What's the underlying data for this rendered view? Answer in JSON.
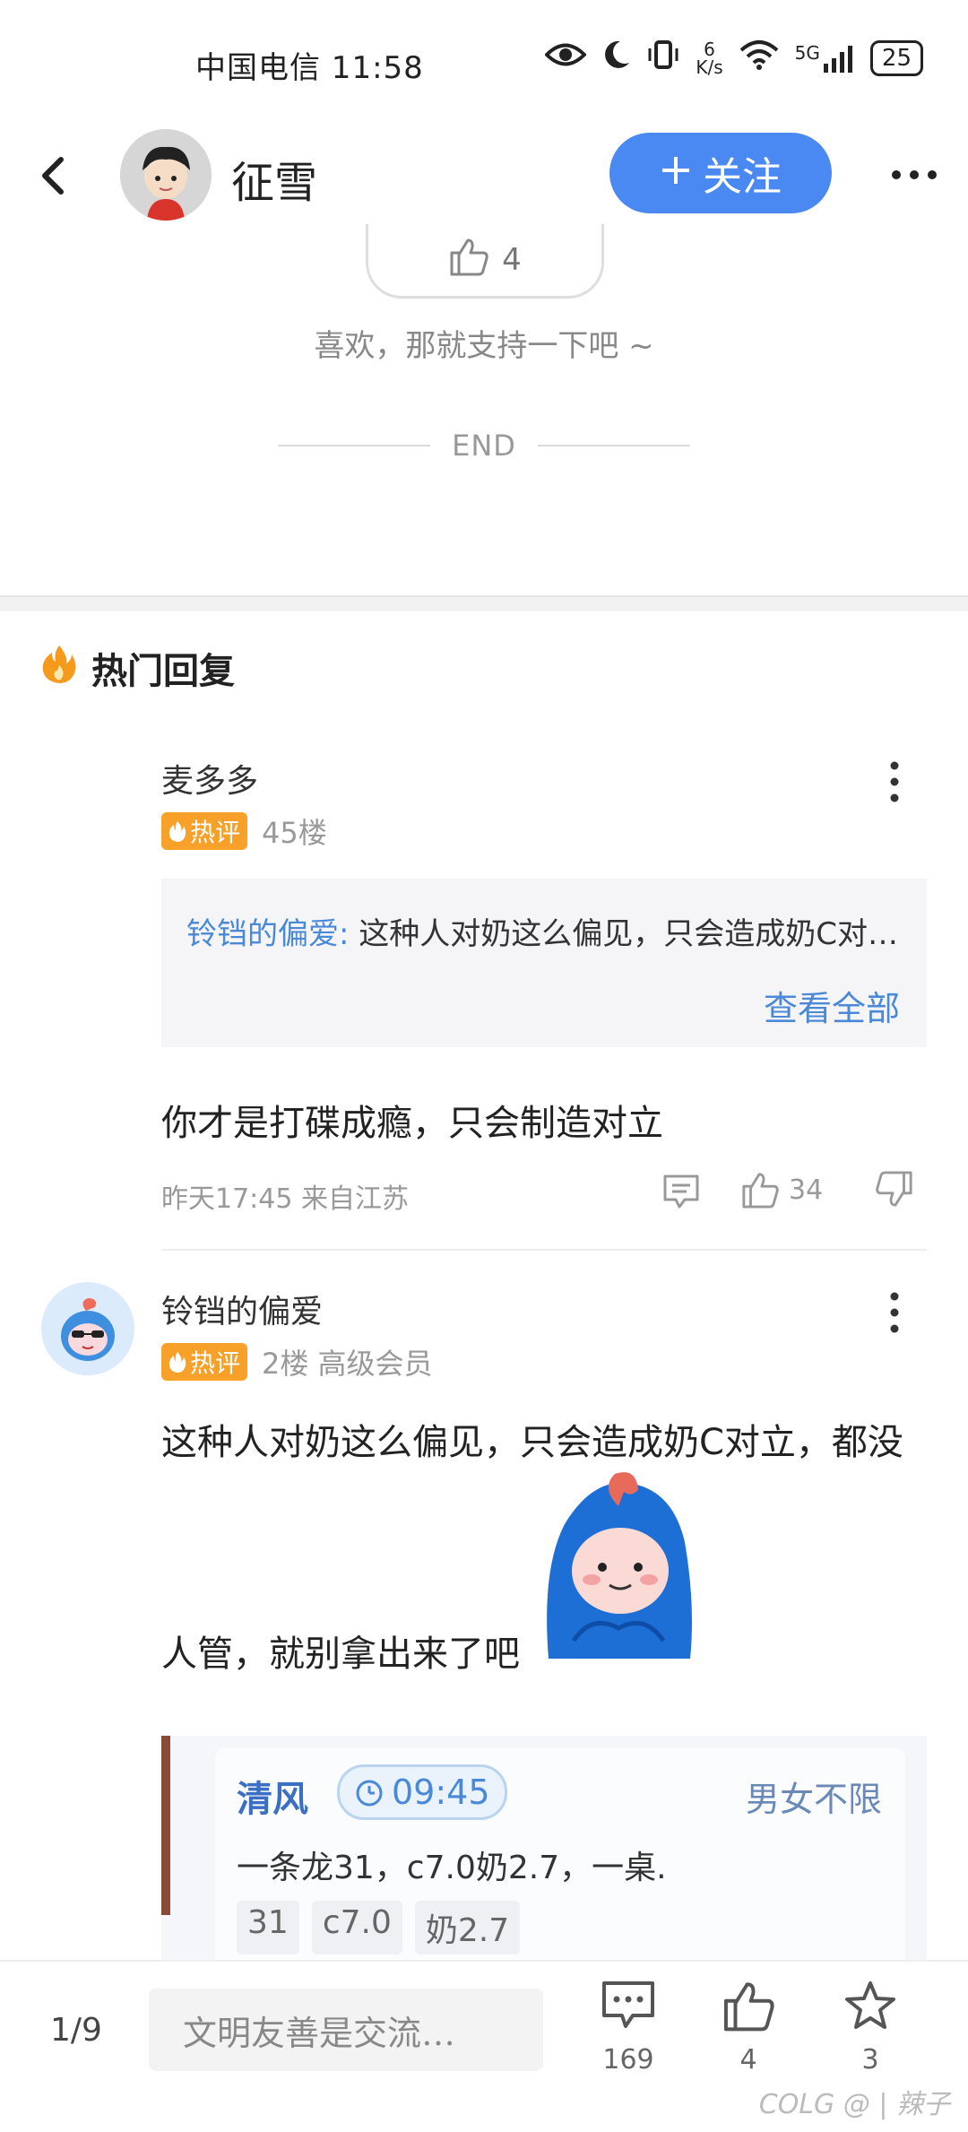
{
  "status_bar": {
    "carrier_time": "中国电信 11:58",
    "net_speed_top": "6",
    "net_speed_bottom": "K/s",
    "net_type": "5G",
    "battery": "25"
  },
  "header": {
    "author_name": "征雪",
    "follow_label": "关注"
  },
  "article_end": {
    "like_count": "4",
    "support_text": "喜欢，那就支持一下吧 ~",
    "end_text": "END"
  },
  "hot_replies": {
    "title": "热门回复",
    "replies": [
      {
        "username": "麦多多",
        "badge": "热评",
        "floor": "45楼",
        "quote_user": "铃铛的偏爱:",
        "quote_text": "这种人对奶这么偏见，只会造成奶C对…",
        "view_all": "查看全部",
        "content": "你才是打碟成瘾，只会制造对立",
        "time_location": "昨天17:45 来自江苏",
        "like_count": "34"
      },
      {
        "username": "铃铛的偏爱",
        "badge": "热评",
        "floor_member": "2楼 高级会员",
        "content_line1": "这种人对奶这么偏见，只会造成奶C对立，都没",
        "content_line2": "人管，就别拿出来了吧",
        "image_card": {
          "name": "清风",
          "time": "09:45",
          "tag": "男女不限",
          "desc": "一条龙31，c7.0奶2.7，一桌.",
          "chips": [
            "31",
            "c7.0",
            "奶2.7"
          ]
        }
      }
    ]
  },
  "bottom_bar": {
    "page_indicator": "1/9",
    "input_placeholder": "文明友善是交流…",
    "comment_count": "169",
    "like_count": "4",
    "favorite_count": "3",
    "watermark": "COLG @ | 辣子"
  },
  "colors": {
    "accent_blue": "#4a88f2",
    "hot_badge": "#f7a02a",
    "link_blue": "#4a88d8"
  }
}
